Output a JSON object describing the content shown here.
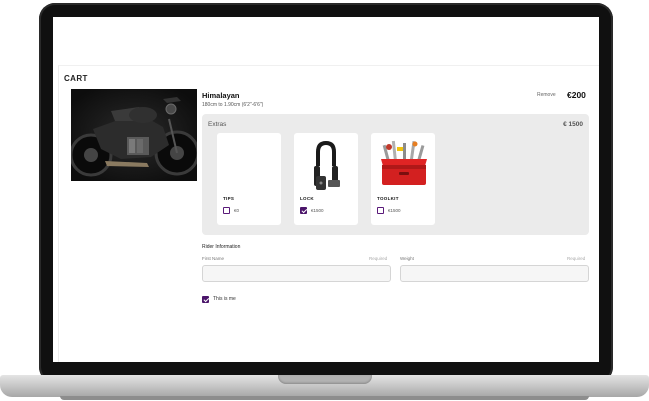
{
  "cart": {
    "title": "CART"
  },
  "product": {
    "name": "Himalayan",
    "size": "180cm to 1.90cm (6'2\"-6'6\")",
    "remove_label": "Remove",
    "price": "€200",
    "image": "motorcycle-photo"
  },
  "extras": {
    "label": "Extras",
    "total": "€ 1500",
    "items": [
      {
        "name": "TIPS",
        "price": "€0",
        "checked": false,
        "icon": "none"
      },
      {
        "name": "LOCK",
        "price": "€1500",
        "checked": true,
        "icon": "u-lock-icon"
      },
      {
        "name": "TOOLKIT",
        "price": "€1500",
        "checked": false,
        "icon": "toolbox-icon"
      }
    ]
  },
  "rider": {
    "title": "Rider Information",
    "first_name": {
      "label": "First Name",
      "required": "Required",
      "value": ""
    },
    "weight": {
      "label": "Weight",
      "required": "Required",
      "value": ""
    },
    "this_is_me": {
      "label": "This is me",
      "checked": true
    }
  },
  "colors": {
    "accent": "#4b156a",
    "extras_bg": "#ebebeb",
    "laptop_bezel": "#101010",
    "toolbox_red": "#d32020"
  }
}
